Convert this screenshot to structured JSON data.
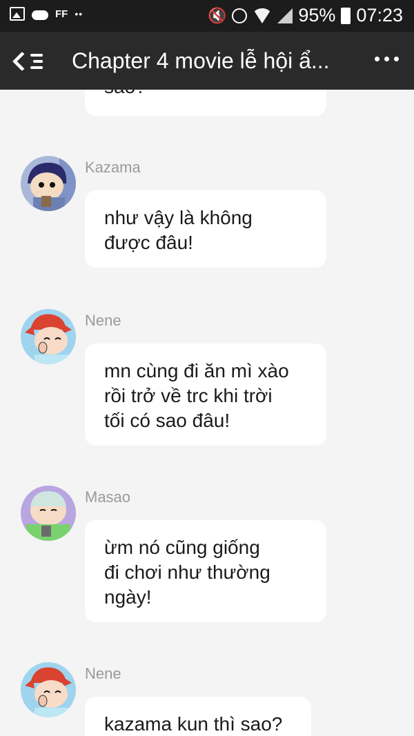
{
  "status_bar": {
    "battery": "95%",
    "time": "07:23",
    "ff_label": "FF",
    "left_icons": [
      "image-icon",
      "cloud-icon",
      "ff-icon",
      "more-dots-icon"
    ],
    "right_icons": [
      "mute-icon",
      "alarm-icon",
      "wifi-icon",
      "signal-icon",
      "battery-icon"
    ]
  },
  "header": {
    "title": "Chapter 4 movie lễ hội ẩ...",
    "icons": [
      "back-chevron-icon",
      "list-icon",
      "more-icon"
    ]
  },
  "chat": {
    "partial_top_text": "sao?",
    "messages": [
      {
        "sender": "Kazama",
        "text": "như vậy là không\nđược đâu!",
        "avatar": "kazama-avatar"
      },
      {
        "sender": "Nene",
        "text": "mn cùng đi ăn mì xào\nrồi trở về trc khi trời\ntối có sao đâu!",
        "avatar": "nene-avatar"
      },
      {
        "sender": "Masao",
        "text": "ừm nó cũng giống\nđi chơi như thường\nngày!",
        "avatar": "masao-avatar"
      },
      {
        "sender": "Nene",
        "text": "kazama kun thì sao?",
        "avatar": "nene-avatar"
      }
    ]
  },
  "colors": {
    "status_bar_bg": "#1c1c1c",
    "header_bg": "#2a2a2a",
    "chat_bg": "#f4f4f4",
    "bubble_bg": "#ffffff",
    "sender_text": "#9a9a9a"
  }
}
